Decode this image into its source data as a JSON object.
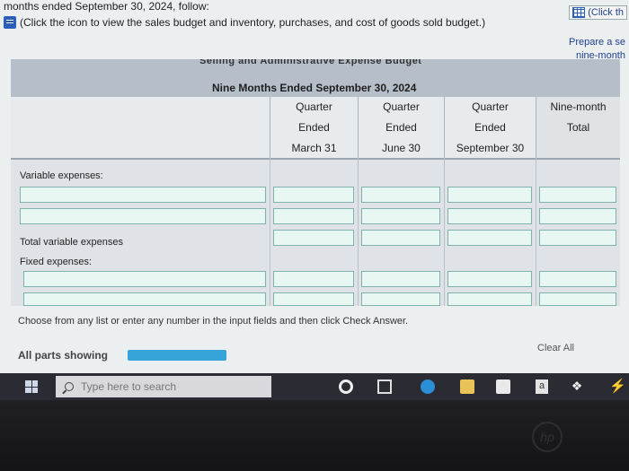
{
  "header": {
    "line1": "months ended September 30, 2024, follow:",
    "line2": "(Click the icon to view the sales budget and inventory, purchases, and cost of goods sold budget.)",
    "click_right": "(Click th",
    "prepare_line1": "Prepare a se",
    "prepare_line2": "nine-month"
  },
  "table": {
    "company_cut": "Selling and Administrative Expense Budget",
    "period": "Nine Months Ended September 30, 2024",
    "columns": [
      {
        "l1": "Quarter",
        "l2": "Ended",
        "l3": "March 31"
      },
      {
        "l1": "Quarter",
        "l2": "Ended",
        "l3": "June 30"
      },
      {
        "l1": "Quarter",
        "l2": "Ended",
        "l3": "September 30"
      },
      {
        "l1": "",
        "l2": "Nine-month",
        "l3": "Total"
      }
    ],
    "variable_label": "Variable expenses:",
    "total_variable_label": "Total variable expenses",
    "fixed_label": "Fixed expenses:"
  },
  "footer": {
    "instructions": "Choose from any list or enter any number in the input fields and then click Check Answer.",
    "all_parts": "All parts showing",
    "clear_all": "Clear All"
  },
  "taskbar": {
    "search_placeholder": "Type here to search",
    "amazon_letter": "a"
  },
  "colors": {
    "progress": "#36a3d9",
    "header_band": "#b6bfc9",
    "input_fill": "#e9f7f3"
  }
}
